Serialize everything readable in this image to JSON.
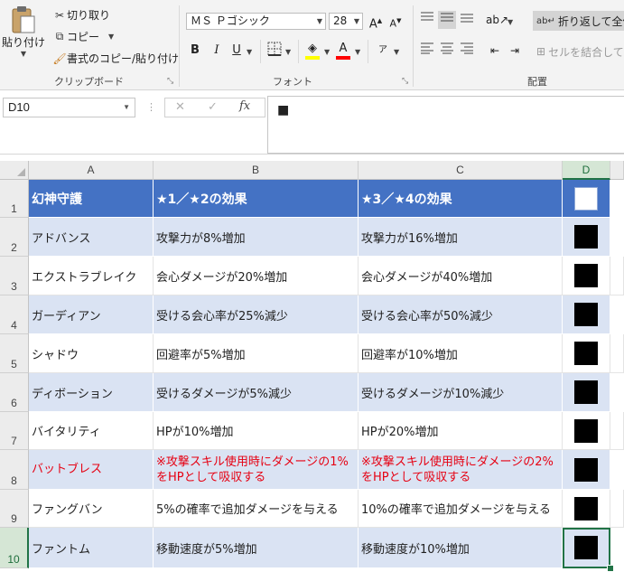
{
  "ribbon": {
    "clipboard": {
      "paste": "貼り付け",
      "cut": "切り取り",
      "copy": "コピー",
      "format_painter": "書式のコピー/貼り付け",
      "group_label": "クリップボード"
    },
    "font": {
      "font_name": "ＭＳ Ｐゴシック",
      "font_size": "28",
      "grow_font": "A",
      "shrink_font": "A",
      "bold": "B",
      "italic": "I",
      "underline": "U",
      "phonetic": "ア",
      "group_label": "フォント",
      "fill_color": "#ffff00",
      "font_color": "#ff0000"
    },
    "alignment": {
      "wrap_text": "折り返して全体を",
      "merge_center": "セルを結合して中",
      "group_label": "配置"
    }
  },
  "formula_bar": {
    "name_box": "D10",
    "cancel_icon": "✕",
    "enter_icon": "✓",
    "fx": "fx",
    "content": "■"
  },
  "columns": [
    "A",
    "B",
    "C",
    "D"
  ],
  "rows": [
    {
      "num": "1",
      "a": "幻神守護",
      "b": "★1／★2の効果",
      "c": "★3／★4の効果",
      "mark": "white"
    },
    {
      "num": "2",
      "a": "アドバンス",
      "b": "攻撃力が8%増加",
      "c": "攻撃力が16%増加",
      "mark": "black"
    },
    {
      "num": "3",
      "a": "エクストラブレイク",
      "b": "会心ダメージが20%増加",
      "c": "会心ダメージが40%増加",
      "mark": "black"
    },
    {
      "num": "4",
      "a": "ガーディアン",
      "b": "受ける会心率が25%減少",
      "c": "受ける会心率が50%減少",
      "mark": "black"
    },
    {
      "num": "5",
      "a": "シャドウ",
      "b": "回避率が5%増加",
      "c": "回避率が10%増加",
      "mark": "black"
    },
    {
      "num": "6",
      "a": "ディボーション",
      "b": "受けるダメージが5%減少",
      "c": "受けるダメージが10%減少",
      "mark": "black"
    },
    {
      "num": "7",
      "a": "バイタリティ",
      "b": "HPが10%増加",
      "c": "HPが20%増加",
      "mark": "black"
    },
    {
      "num": "8",
      "a": "バットブレス",
      "b": "※攻撃スキル使用時にダメージの1%をHPとして吸収する",
      "c": "※攻撃スキル使用時にダメージの2%をHPとして吸収する",
      "mark": "black"
    },
    {
      "num": "9",
      "a": "ファングバン",
      "b": "5%の確率で追加ダメージを与える",
      "c": "10%の確率で追加ダメージを与える",
      "mark": "black"
    },
    {
      "num": "10",
      "a": "ファントム",
      "b": "移動速度が5%増加",
      "c": "移動速度が10%増加",
      "mark": "black"
    }
  ],
  "colors": {
    "header_fill": "#4472c4",
    "band_fill": "#dae3f3",
    "warning_text": "#e60012",
    "selection": "#217346"
  }
}
